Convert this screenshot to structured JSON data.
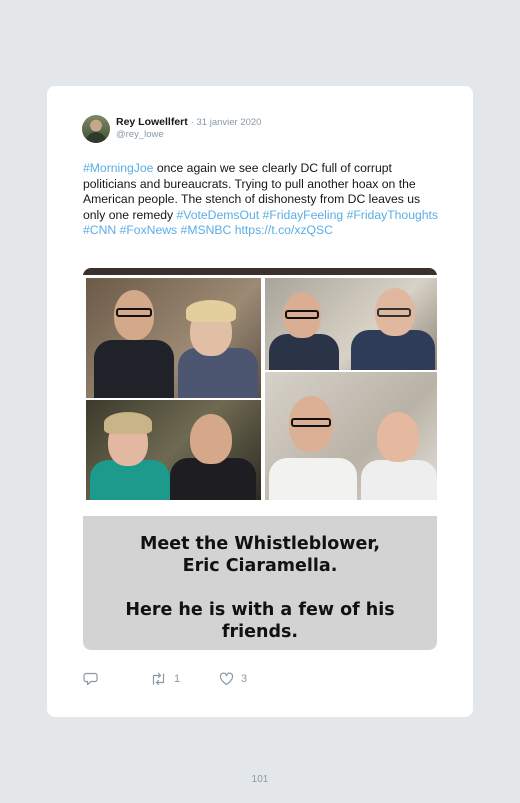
{
  "tweet": {
    "author_name": "Rey Lowellfert",
    "date": "· 31 janvier 2020",
    "handle": "@rey_lowe",
    "text_parts": [
      {
        "text": "#MorningJoe",
        "link": true
      },
      {
        "text": " once again we see clearly DC full of corrupt politicians and bureaucrats. Trying to pull another hoax on the American people. The stench of dishonesty from DC leaves us only one remedy ",
        "link": false
      },
      {
        "text": "#VoteDemsOut",
        "link": true
      },
      {
        "text": " ",
        "link": false
      },
      {
        "text": "#FridayFeeling",
        "link": true
      },
      {
        "text": " ",
        "link": false
      },
      {
        "text": "#FridayThoughts",
        "link": true
      },
      {
        "text": " ",
        "link": false
      },
      {
        "text": "#CNN",
        "link": true
      },
      {
        "text": " ",
        "link": false
      },
      {
        "text": "#FoxNews",
        "link": true
      },
      {
        "text": " ",
        "link": false
      },
      {
        "text": "#MSNBC",
        "link": true
      },
      {
        "text": " ",
        "link": false
      },
      {
        "text": "https://t.co/xzQSC",
        "link": true
      }
    ],
    "image_caption_line1": "Meet the Whistleblower,",
    "image_caption_line2": "Eric Ciaramella.",
    "image_caption_line3": "Here he is with a few of his",
    "image_caption_line4": "friends.",
    "reply_count": "",
    "retweet_count": "1",
    "like_count": "3"
  },
  "page_number": "101",
  "colors": {
    "link": "#5aaee6",
    "background": "#e3e7ea",
    "icon": "#8899a6"
  },
  "icons": {
    "reply": "reply-icon",
    "retweet": "retweet-icon",
    "like": "heart-icon"
  }
}
